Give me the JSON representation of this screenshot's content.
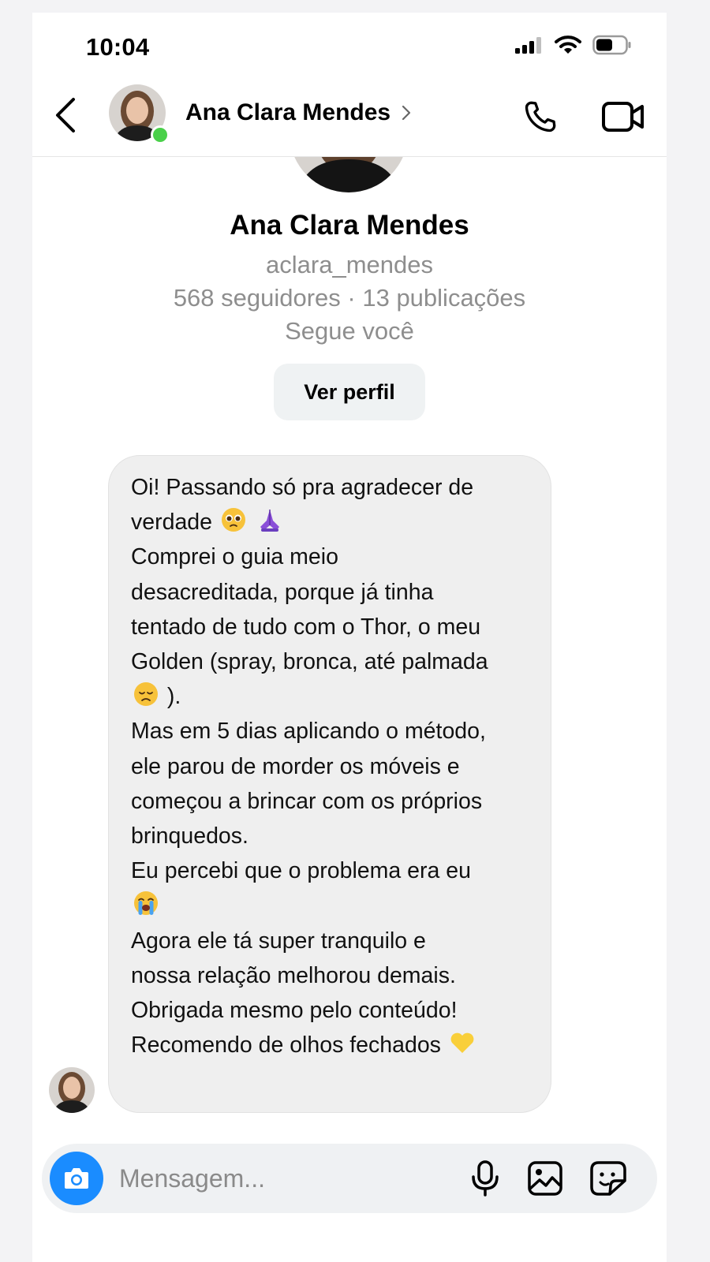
{
  "status_bar": {
    "time": "10:04"
  },
  "header": {
    "name": "Ana Clara Mendes",
    "online": true
  },
  "profile": {
    "name": "Ana Clara Mendes",
    "username": "aclara_mendes",
    "stats": "568 seguidores · 13 publicações",
    "follows_you": "Segue você",
    "view_profile_label": "Ver perfil"
  },
  "message": {
    "lines": [
      "Oi! Passando só pra agradecer de",
      "verdade",
      "Comprei o guia meio",
      "desacreditada, porque já tinha",
      "tentado de tudo com o Thor, o meu",
      "Golden (spray, bronca, até palmada",
      ").",
      "Mas em 5 dias aplicando o método,",
      "ele parou de morder os móveis e",
      "começou a brincar com os próprios",
      "brinquedos.",
      "Eu percebi que o problema era eu",
      "",
      "Agora ele tá super tranquilo e",
      "nossa relação melhorou demais.",
      "Obrigada mesmo pelo conteúdo!",
      "Recomendo de olhos fechados"
    ],
    "emojis": {
      "line_2": [
        "pleading-face",
        "folded-hands"
      ],
      "line_7": [
        "disappointed-face"
      ],
      "line_13": [
        "loudly-crying-face"
      ],
      "line_17": [
        "yellow-heart"
      ]
    }
  },
  "composer": {
    "placeholder": "Mensagem...",
    "icons": [
      "camera-icon",
      "microphone-icon",
      "gallery-icon",
      "sticker-icon"
    ]
  },
  "colors": {
    "accent_blue": "#1a8cff",
    "online_green": "#4ad04a",
    "bubble_bg": "#efefef",
    "muted_text": "#8e8e8e"
  }
}
